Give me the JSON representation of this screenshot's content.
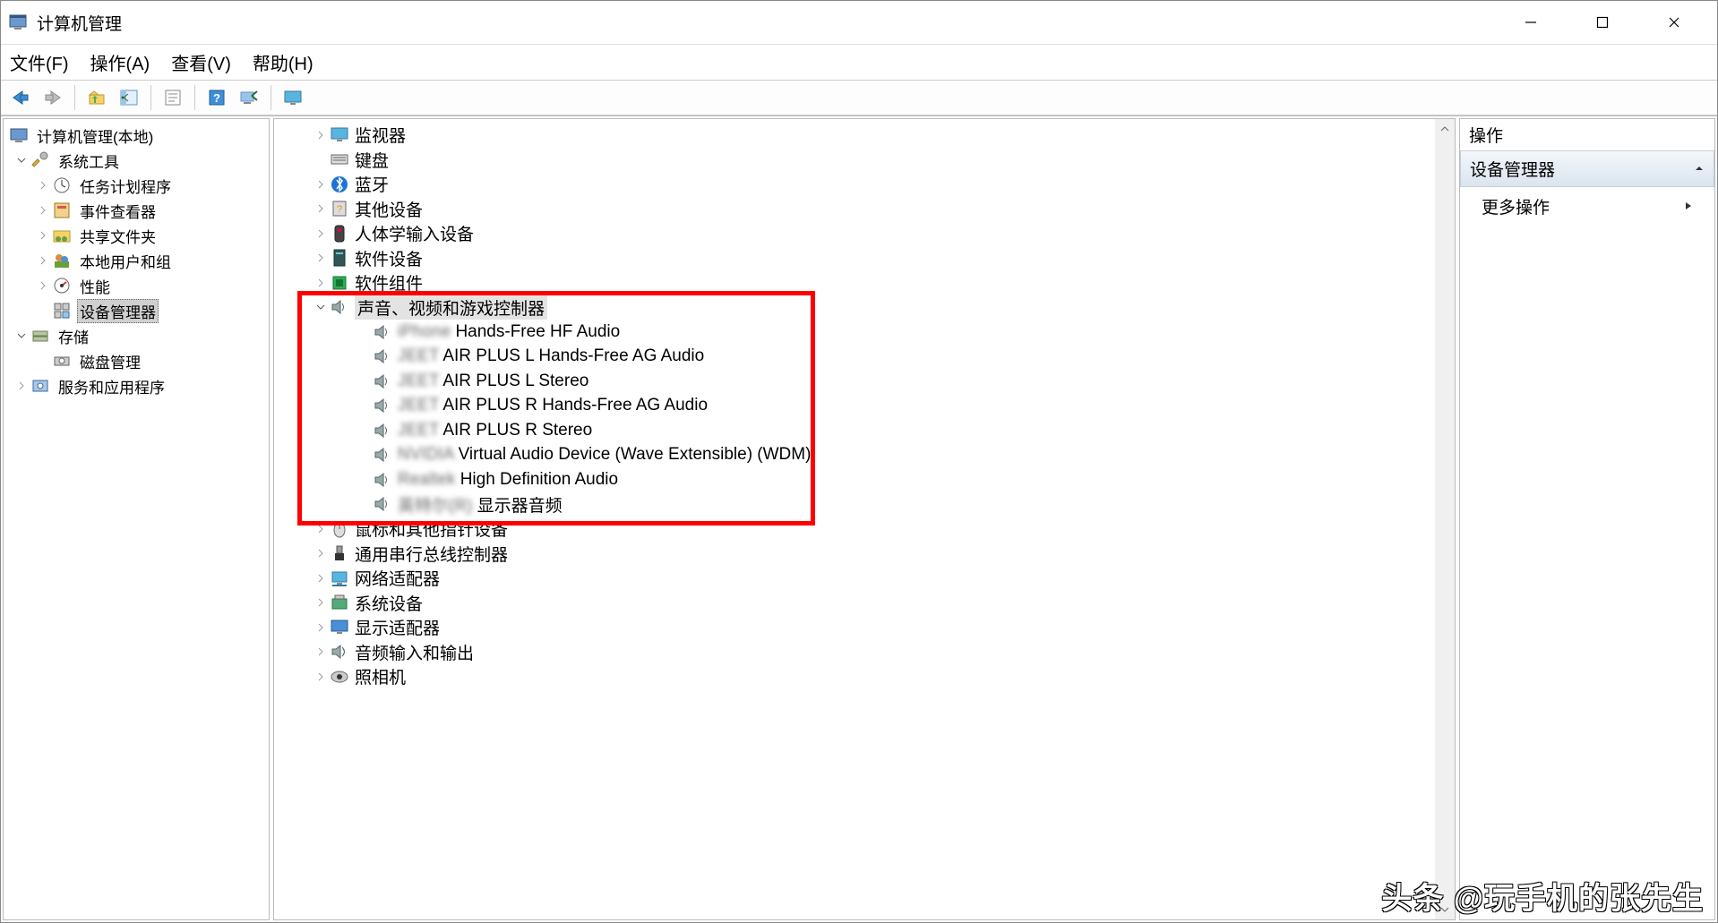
{
  "window": {
    "title": "计算机管理"
  },
  "menu": {
    "file": "文件(F)",
    "action": "操作(A)",
    "view": "查看(V)",
    "help": "帮助(H)"
  },
  "leftTree": {
    "root": "计算机管理(本地)",
    "sysTools": "系统工具",
    "taskScheduler": "任务计划程序",
    "eventViewer": "事件查看器",
    "sharedFolders": "共享文件夹",
    "localUsers": "本地用户和组",
    "performance": "性能",
    "deviceManager": "设备管理器",
    "storage": "存储",
    "diskMgmt": "磁盘管理",
    "services": "服务和应用程序"
  },
  "devTree": {
    "monitors": "监视器",
    "keyboards": "键盘",
    "bluetooth": "蓝牙",
    "otherDevices": "其他设备",
    "hid": "人体学输入设备",
    "softwareDevices": "软件设备",
    "softwareComponents": "软件组件",
    "sound": "声音、视频和游戏控制器",
    "soundItems": [
      {
        "prefix": "iPhone",
        "label": "Hands-Free HF Audio"
      },
      {
        "prefix": "JEET",
        "label": "AIR PLUS L Hands-Free AG Audio"
      },
      {
        "prefix": "JEET",
        "label": "AIR PLUS L Stereo"
      },
      {
        "prefix": "JEET",
        "label": "AIR PLUS R Hands-Free AG Audio"
      },
      {
        "prefix": "JEET",
        "label": "AIR PLUS R Stereo"
      },
      {
        "prefix": "NVIDIA",
        "label": "Virtual Audio Device (Wave Extensible) (WDM)"
      },
      {
        "prefix": "Realtek",
        "label": "High Definition Audio"
      },
      {
        "prefix": "英特尔(R)",
        "label": "显示器音频"
      }
    ],
    "mice": "鼠标和其他指针设备",
    "usb": "通用串行总线控制器",
    "network": "网络适配器",
    "system": "系统设备",
    "display": "显示适配器",
    "audioIO": "音频输入和输出",
    "cameras": "照相机"
  },
  "actions": {
    "header": "操作",
    "section": "设备管理器",
    "more": "更多操作"
  },
  "watermark": "头条 @玩手机的张先生"
}
